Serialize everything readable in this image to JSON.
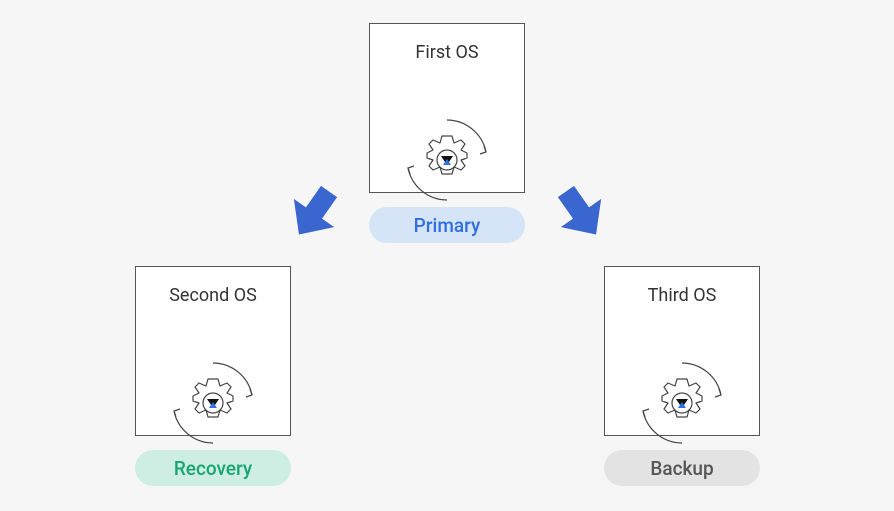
{
  "nodes": {
    "first": {
      "title": "First OS",
      "tag": "Primary"
    },
    "second": {
      "title": "Second OS",
      "tag": "Recovery"
    },
    "third": {
      "title": "Third OS",
      "tag": "Backup"
    }
  },
  "icons": {
    "gear": "gear-cycle-icon",
    "arrow": "block-arrow-icon"
  },
  "colors": {
    "arrow": "#3a66cf",
    "primary_bg": "#d6e4f7",
    "primary_fg": "#2f6fe0",
    "recovery_bg": "#cfeee3",
    "recovery_fg": "#17a673",
    "backup_bg": "#e3e3e3",
    "backup_fg": "#555555"
  }
}
